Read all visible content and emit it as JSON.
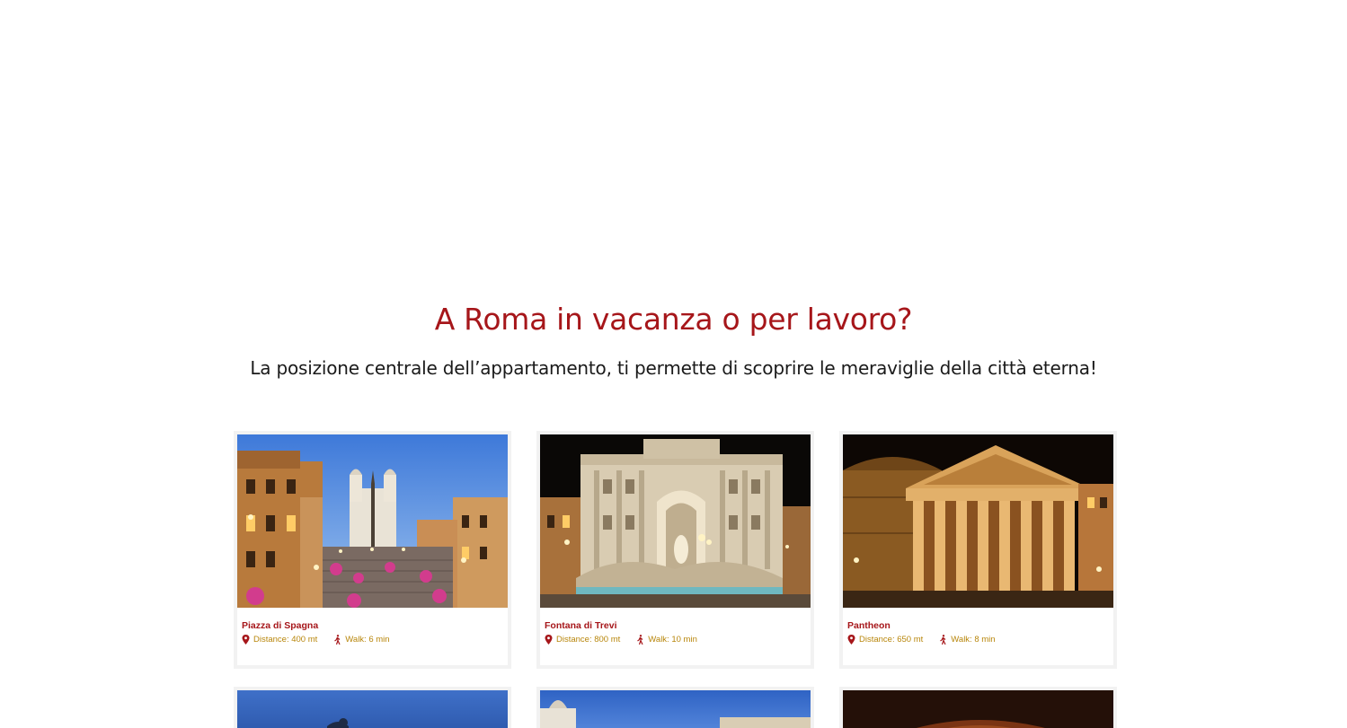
{
  "section": {
    "title": "A Roma in vacanza o per lavoro?",
    "subtitle": "La posizione centrale dell’appartamento, ti permette di scoprire le meraviglie della città eterna!"
  },
  "cards": [
    {
      "name": "Piazza di Spagna",
      "distance": "Distance: 400 mt",
      "walk": "Walk: 6 min",
      "photo": "spanish-steps-night"
    },
    {
      "name": "Fontana di Trevi",
      "distance": "Distance: 800 mt",
      "walk": "Walk: 10 min",
      "photo": "trevi-fountain-night"
    },
    {
      "name": "Pantheon",
      "distance": "Distance: 650 mt",
      "walk": "Walk: 8 min",
      "photo": "pantheon-night"
    }
  ],
  "colors": {
    "accent": "#a6161a",
    "meta": "#b8860b",
    "text": "#1a1a1a"
  },
  "icons": {
    "distance": "map-pin-icon",
    "walk": "walking-person-icon"
  }
}
